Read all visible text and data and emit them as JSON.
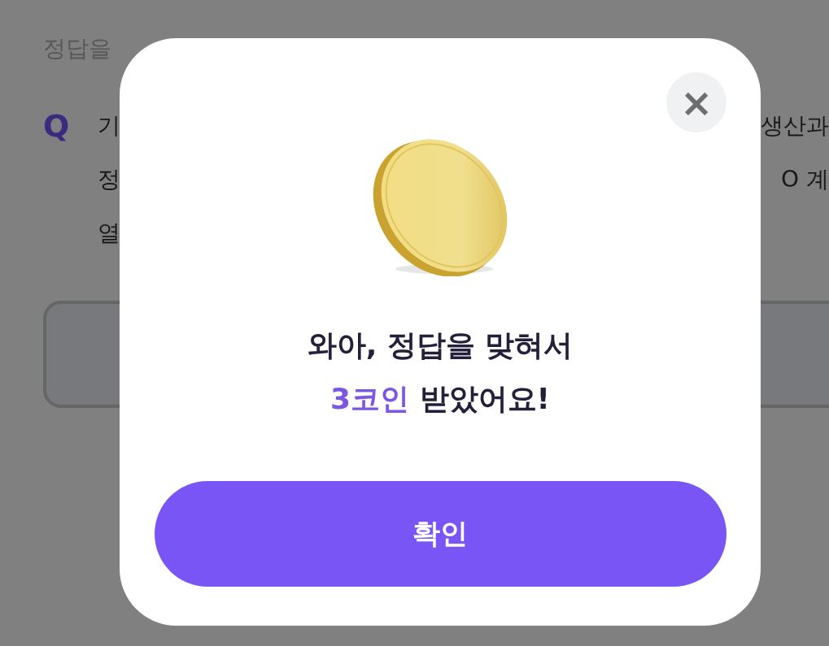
{
  "background": {
    "instruction": "정답을",
    "question_mark": "Q",
    "question_lines": [
      {
        "left": "기",
        "right": "생산과"
      },
      {
        "left": "정",
        "right": "O 계"
      },
      {
        "left": "열"
      }
    ]
  },
  "dialog": {
    "close_label": "×",
    "message_line1": "와아, 정답을 맞혀서",
    "reward": "3코인",
    "message_line2_rest": "받았어요!",
    "confirm_button": "확인"
  }
}
